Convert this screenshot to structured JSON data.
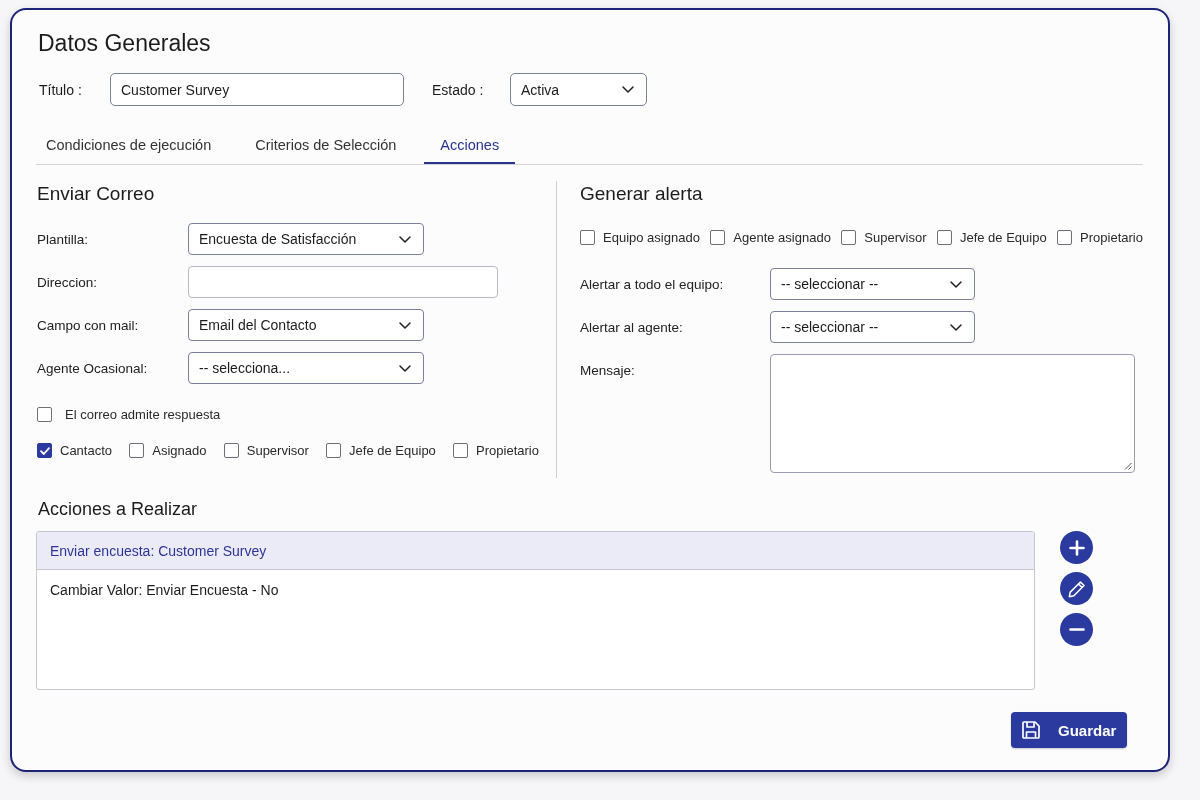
{
  "header": {
    "title": "Datos Generales"
  },
  "general_fields": [
    {
      "label": "Título :",
      "kind": "input",
      "value": "Customer Survey"
    },
    {
      "label": "Estado :",
      "kind": "select",
      "value": "Activa"
    }
  ],
  "tabs": [
    {
      "label": "Condiciones de ejecución",
      "selected": false
    },
    {
      "label": "Criterios de Selección",
      "selected": false
    },
    {
      "label": "Acciones",
      "selected": true
    }
  ],
  "send_email": {
    "title": "Enviar Correo",
    "fields": [
      {
        "label": "Plantilla:",
        "kind": "select",
        "value": "Encuesta de Satisfacción"
      },
      {
        "label": "Direccion:",
        "kind": "input"
      },
      {
        "label": "Campo con mail:",
        "kind": "select",
        "value": "Email del Contacto"
      },
      {
        "label": "Agente Ocasional:",
        "kind": "select",
        "value": "-- selecciona..."
      }
    ],
    "reply_option": {
      "label": "El correo admite respuesta",
      "checked": false
    },
    "recipients": [
      {
        "label": "Cantacto",
        "checked": true
      },
      {
        "label": "Asignado",
        "checked": false
      },
      {
        "label": "Supervisor",
        "checked": false
      },
      {
        "label": "Jefe de Equipo",
        "checked": false
      },
      {
        "label": "Propietario",
        "checked": false
      }
    ]
  },
  "alert": {
    "title": "Generar alerta",
    "recipients": [
      {
        "label": "Equipo asignado",
        "checked": false
      },
      {
        "label": "Agente asignado",
        "checked": false
      },
      {
        "label": "Supervisor",
        "checked": false
      },
      {
        "label": "Jefe de Equipo",
        "checked": false
      },
      {
        "label": "Propietario",
        "checked": false
      }
    ],
    "fields": [
      {
        "label": "Alertar a todo el equipo:",
        "kind": "select",
        "value": "-- seleccionar --"
      },
      {
        "label": "Alertar al agente:",
        "kind": "select",
        "value": "-- seleccionar --"
      },
      {
        "label": "Mensaje:",
        "kind": "textarea"
      }
    ]
  },
  "actions": {
    "title": "Acciones a Realizar",
    "items": [
      {
        "text": "Enviar encuesta: Customer Survey",
        "selected": true
      },
      {
        "text": "Cambiar Valor: Enviar Encuesta - No",
        "selected": false
      }
    ]
  },
  "save_button": {
    "label": "Guardar"
  }
}
